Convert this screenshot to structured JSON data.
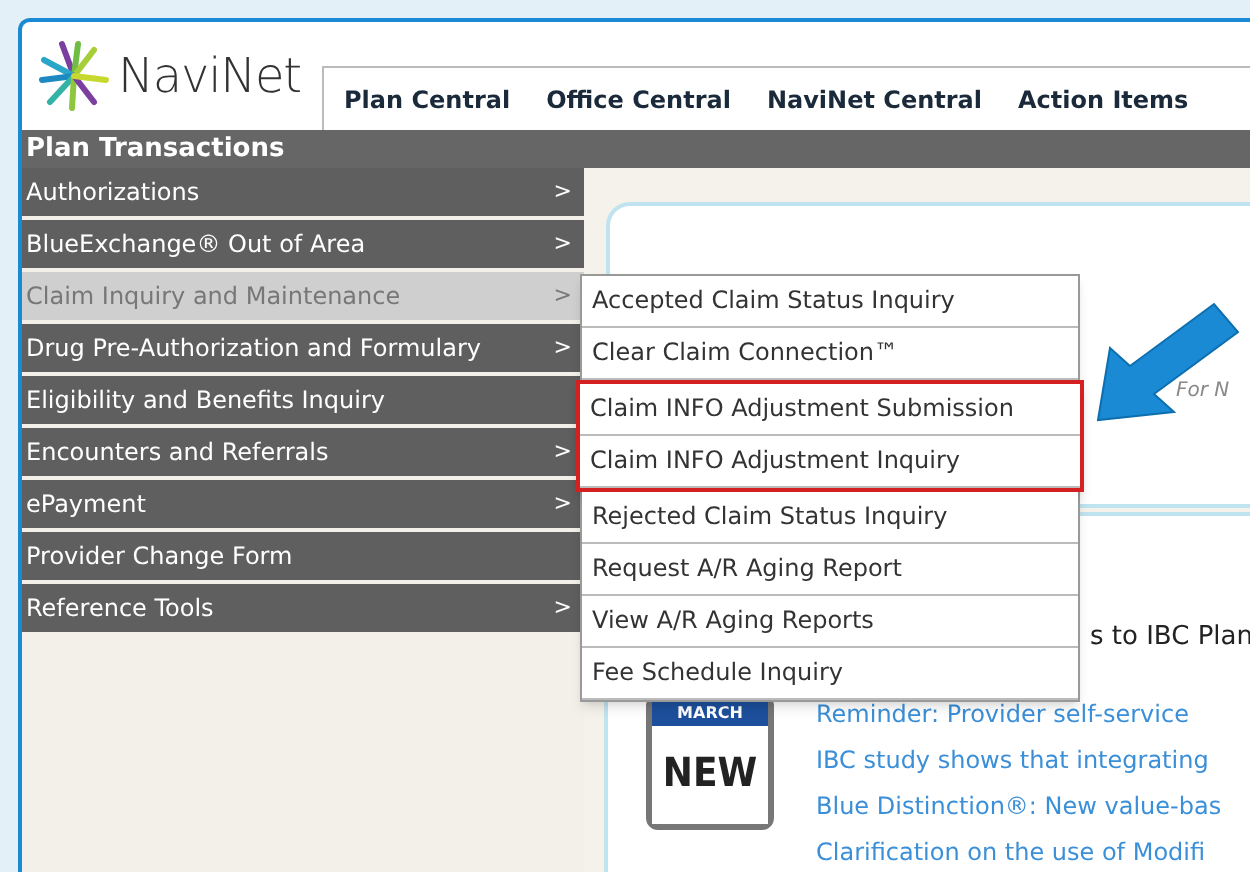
{
  "logo": {
    "text": "NaviNet"
  },
  "tabs": [
    {
      "label": "Plan Central"
    },
    {
      "label": "Office Central"
    },
    {
      "label": "NaviNet Central"
    },
    {
      "label": "Action Items"
    }
  ],
  "sidebar": {
    "title": "Plan Transactions",
    "items": [
      {
        "label": "Authorizations",
        "arrow": ">",
        "selected": false
      },
      {
        "label": "BlueExchange® Out of Area",
        "arrow": ">",
        "selected": false
      },
      {
        "label": "Claim Inquiry and Maintenance",
        "arrow": ">",
        "selected": true
      },
      {
        "label": "Drug Pre-Authorization and Formulary",
        "arrow": ">",
        "selected": false
      },
      {
        "label": "Eligibility and Benefits Inquiry",
        "selected": false
      },
      {
        "label": "Encounters and Referrals",
        "arrow": ">",
        "selected": false
      },
      {
        "label": "ePayment",
        "arrow": ">",
        "selected": false
      },
      {
        "label": "Provider Change Form",
        "selected": false
      },
      {
        "label": "Reference Tools",
        "arrow": ">",
        "selected": false
      }
    ]
  },
  "submenu": {
    "items": [
      {
        "label": "Accepted Claim Status Inquiry",
        "highlighted": false
      },
      {
        "label": "Clear Claim Connection™",
        "highlighted": false
      },
      {
        "label": "Claim INFO Adjustment Submission",
        "highlighted": true
      },
      {
        "label": "Claim INFO Adjustment Inquiry",
        "highlighted": true
      },
      {
        "label": "Rejected Claim Status Inquiry",
        "highlighted": false
      },
      {
        "label": "Request A/R Aging Report",
        "highlighted": false
      },
      {
        "label": "View A/R Aging Reports",
        "highlighted": false
      },
      {
        "label": "Fee Schedule Inquiry",
        "highlighted": false
      }
    ]
  },
  "content": {
    "note": "For N",
    "heading": "s to IBC Plan",
    "calendar": {
      "month": "MARCH",
      "badge": "NEW"
    },
    "news": [
      "Reminder: Provider self-service",
      "IBC study shows that integrating",
      "Blue Distinction®: New value-bas",
      "Clarification on the use of Modifi"
    ]
  }
}
